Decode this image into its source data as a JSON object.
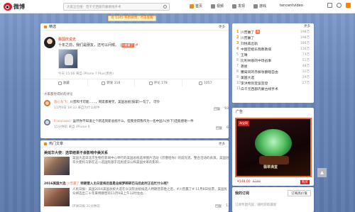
{
  "app": {
    "name": "微博"
  },
  "search": {
    "placeholder": "大家正在搜：范千元西部内蒙路线手术"
  },
  "nav": {
    "items": [
      {
        "label": "首页",
        "icon": "home-icon"
      },
      {
        "label": "视频",
        "icon": "video-icon"
      },
      {
        "label": "发现",
        "icon": "discover-icon"
      },
      {
        "label": "游戏",
        "icon": "game-icon"
      }
    ],
    "username": "tencentvideo"
  },
  "notice": {
    "text": "有 1245 条新微博，点击查看"
  },
  "feed_card": {
    "header_label": "精选",
    "header_more": "更多",
    "post": {
      "author": "蔡国庆说史",
      "text": "十年之前，我们是朋友，还可以问候。",
      "topic_badge": "[",
      "topic": "川普赢了",
      "topic_suffix": "]#",
      "meta": "今天 15:06 来自 iPhone 7 Plus(黑色)"
    },
    "actions": [
      {
        "label": "收藏",
        "icon": "favorite-icon"
      },
      {
        "label": "转发 318",
        "icon": "repost-icon"
      },
      {
        "label": "评论 178",
        "icon": "comment-icon"
      },
      {
        "label": "1057",
        "icon": "like-icon"
      }
    ],
    "comments_header": "大家都觉得好的评论",
    "comments": [
      {
        "name": "放心东飞",
        "text": "：川普和卡可能……，网友都要笑，美国总统[鼓掌]一句了。 可怜",
        "meta": "11月9日 19:33 来自为什么很牛",
        "reply": "回复",
        "likes": "93"
      },
      {
        "name": "Francissei",
        "text": "：虽然你不知道之个新选到新总统什么。但我觉得我作为一名中国人[抄下]还能感谢一件",
        "meta": "15分钟前 来自 iPhone 6",
        "reply": "回复",
        "likes": "6"
      }
    ]
  },
  "hot_article": {
    "header_label": "热门文章",
    "header_more": "更多",
    "title": "美延华大使：选举结果不会影响中美关系",
    "rows": [
      {
        "text": "美国大选日北京生物在新闻中心举行的美国总统选举图片活动《芬塞给你》的前兄弟。整合活动的表演。美国驻华大使托马斯在这一选国际基于选民提法公和美国文革的影响...",
        "meta": "",
        "reply": "",
        "likes": ""
      },
      {
        "title": "2016美国大选",
        "tag": "川普赢了",
        "text": "特朗普入主白宫将后首是总统梦碎碎巴马后此时正在忙什么呢？",
        "sub": "人民日报：美国2016美国总统大选在众议院总统候选人特朗普获胜之后，#川普嬴了# 11月8日投票，美国民众将选出二十年来特朗普的11月9日上午12时左右...",
        "meta": "环球日报  31分钟前",
        "reply": "回复",
        "likes": "13"
      }
    ]
  },
  "realtime_hot": {
    "more": "更多",
    "items": [
      {
        "rank": "1",
        "title": "川普赢了",
        "badge": "热",
        "count": "198万"
      },
      {
        "rank": "2",
        "title": "川普赢了",
        "badge": "",
        "count": "198万"
      },
      {
        "rank": "3",
        "title": "刘悦威出轨",
        "badge": "",
        "count": "186万"
      },
      {
        "rank": "4",
        "title": "中国空姐乐我教教病",
        "badge": "",
        "count": "116万"
      },
      {
        "rank": "5",
        "title": "王晴",
        "badge": "",
        "count": "73万"
      },
      {
        "rank": "6",
        "title": "比利林恩的中场战事",
        "badge": "",
        "count": "51万"
      },
      {
        "rank": "7",
        "title": "艳星",
        "badge": "",
        "count": "48万"
      },
      {
        "rank": "8",
        "title": "腰闺间的赤摒妆翻唱自由",
        "badge": "",
        "count": "31万"
      },
      {
        "rank": "9",
        "title": "美国大选",
        "badge": "",
        "count": "29万"
      },
      {
        "rank": "10",
        "title": "李洪希凯宝案宣登",
        "badge": "",
        "count": "27万"
      },
      {
        "rank": "11",
        "title": "白千元西部内蒙古线手术",
        "badge": "",
        "count": ""
      }
    ]
  },
  "ad": {
    "header_label": "广告",
    "shop_tag": "淘宝网",
    "stamp_text": "翡翠满堂",
    "price": "¥148.00",
    "old_price": "¥298",
    "buy_label": "购买"
  },
  "subscription": {
    "title": "我的订阅",
    "button": "订阅高价值",
    "text": "订阅专题内容，随时获取最新"
  },
  "colors": {
    "accent": "#ff8200",
    "link": "#eb7350",
    "brand_red": "#e6162d"
  }
}
